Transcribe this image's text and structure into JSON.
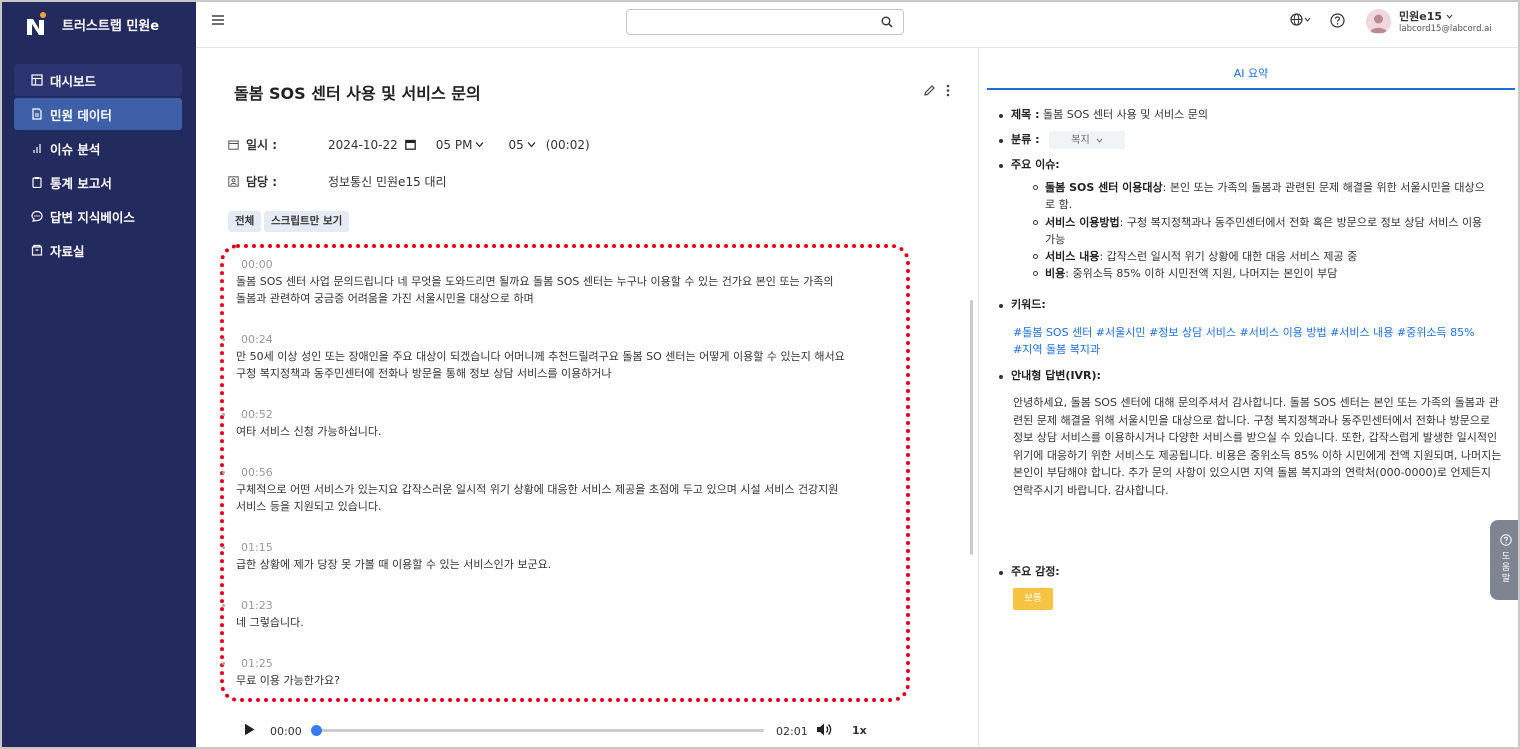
{
  "app": {
    "name": "트러스트랩 민원e"
  },
  "nav": [
    {
      "label": "대시보드",
      "icon": "dashboard-icon"
    },
    {
      "label": "민원 데이터",
      "icon": "document-icon"
    },
    {
      "label": "이슈 분석",
      "icon": "bar-chart-icon"
    },
    {
      "label": "통계 보고서",
      "icon": "clipboard-icon"
    },
    {
      "label": "답변 지식베이스",
      "icon": "chat-icon"
    },
    {
      "label": "자료실",
      "icon": "archive-icon"
    }
  ],
  "header": {
    "search_placeholder": "",
    "user": {
      "name": "민원e15",
      "email": "labcord15@labcord.ai"
    }
  },
  "main": {
    "title": "돌봄 SOS 센터 사용 및 서비스 문의",
    "datetime": {
      "label": "일시 :",
      "date": "2024-10-22",
      "hour": "05 PM",
      "minute": "05",
      "duration": "(00:02)"
    },
    "assignee": {
      "label": "담당 :",
      "value": "정보통신 민원e15 대리"
    },
    "tabs": [
      "전체",
      "스크립트만 보기"
    ]
  },
  "transcript": [
    {
      "time": "00:00",
      "text": "돌봄 SOS 센터 사업 문의드립니다 네 무엇을 도와드리면 될까요 돌봄 SOS 센터는 누구나 이용할 수 있는 건가요 본인 또는 가족의 돌봄과 관련하여 궁금증 어려움을 가진 서울시민을 대상으로 하며"
    },
    {
      "time": "00:24",
      "text": "만 50세 이상 성인 또는 장애인을 주요 대상이 되겠습니다 어머니께 추천드릴려구요 돌봄 SO 센터는 어떻게 이용할 수 있는지 해서요 구청 복지정책과 동주민센터에 전화나 방문을 통해 정보 상담 서비스를 이용하거나"
    },
    {
      "time": "00:52",
      "text": "여타 서비스 신청 가능하십니다."
    },
    {
      "time": "00:56",
      "text": "구체적으로 어떤 서비스가 있는지요 갑작스러운 일시적 위기 상황에 대응한 서비스 제공을 초점에 두고 있으며 시설 서비스 건강지원 서비스 등을 지원되고 있습니다."
    },
    {
      "time": "01:15",
      "text": "급한 상황에 제가 당장 못 가볼 때 이용할 수 있는 서비스인가 보군요."
    },
    {
      "time": "01:23",
      "text": "네 그렇습니다."
    },
    {
      "time": "01:25",
      "text": "무료 이용 가능한가요?"
    }
  ],
  "audio": {
    "current": "00:00",
    "duration": "02:01",
    "speed": "1x",
    "progress": 0
  },
  "summary": {
    "tab": "AI 요약",
    "title_label": "제목 :",
    "title_value": "돌봄 SOS 센터 사용 및 서비스 문의",
    "category_label": "분류 :",
    "category_value": "복지",
    "issues_label": "주요 이슈:",
    "issues": [
      {
        "bold": "돌봄 SOS 센터 이용대상",
        "text": ": 본인 또는 가족의 돌봄과 관련된 문제 해결을 위한 서울시민을 대상으로 함."
      },
      {
        "bold": "서비스 이용방법",
        "text": ": 구청 복지정책과나 동주민센터에서 전화 혹은 방문으로 정보 상담 서비스 이용 가능"
      },
      {
        "bold": "서비스 내용",
        "text": ": 갑작스런 일시적 위기 상황에 대한 대응 서비스 제공 중"
      },
      {
        "bold": "비용",
        "text": ": 중위소득 85% 이하 시민전액 지원, 나머지는 본인이 부담"
      }
    ],
    "keywords_label": "키워드:",
    "keywords": "#돌봄 SOS 센터  #서울시민  #정보 상담 서비스  #서비스 이용 방법  #서비스 내용  #중위소득 85%  #지역 돌봄 복지과",
    "ivr_label": "안내형 답변(IVR):",
    "ivr_text": "안녕하세요, 돌봄 SOS 센터에 대해 문의주셔서 감사합니다. 돌봄 SOS 센터는 본인 또는 가족의 돌봄과 관련된 문제 해결을 위해 서울시민을 대상으로 합니다. 구청 복지정책과나 동주민센터에서 전화나 방문으로 정보 상담 서비스를 이용하시거나 다양한 서비스를 받으실 수 있습니다. 또한, 갑작스럽게 발생한 일시적인 위기에 대응하기 위한 서비스도 제공됩니다. 비용은 중위소득 85% 이하 시민에게 전액 지원되며, 나머지는 본인이 부담해야 합니다. 추가 문의 사항이 있으시면 지역 돌봄 복지과의 연락처(000-0000)로 언제든지 연락주시기 바랍니다. 감사합니다.",
    "emotion_label": "주요 감정:",
    "emotion_value": "보통"
  },
  "help_tab": {
    "label": "도움말"
  },
  "colors": {
    "sidebar": "#232a5e",
    "active_nav": "#3c5fa8",
    "accent": "#1e6fd9",
    "highlight_border": "#e4001b",
    "emotion_badge": "#f6c342"
  }
}
